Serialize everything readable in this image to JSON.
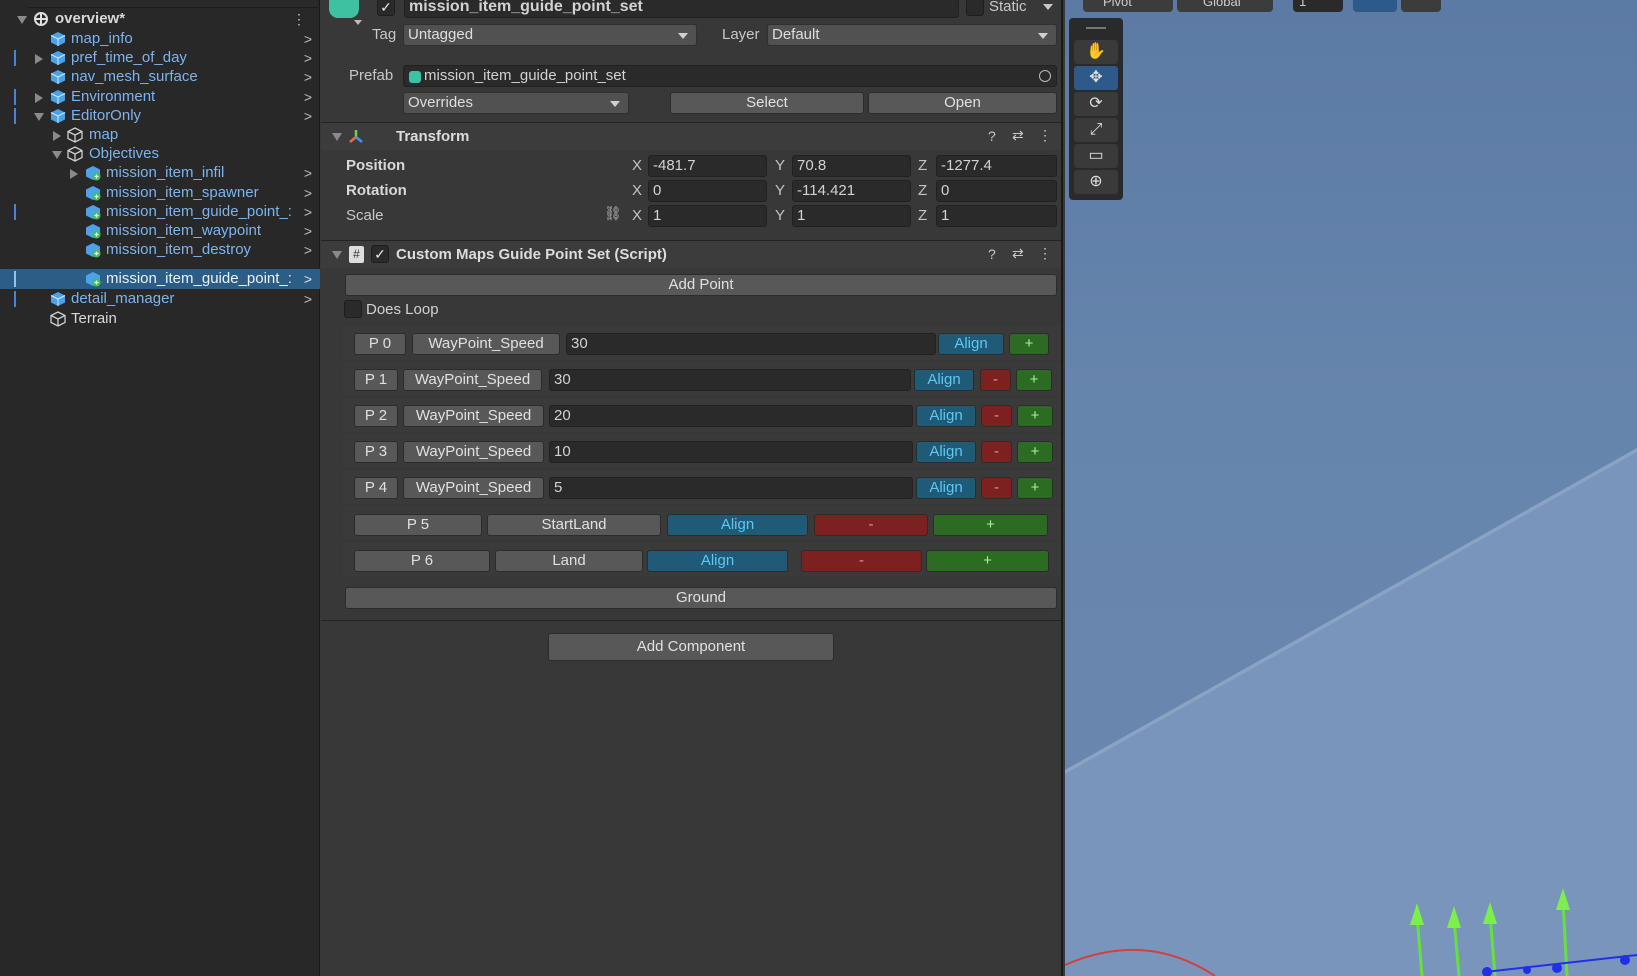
{
  "hierarchy": {
    "items": [
      {
        "label": "overview*",
        "color": "white",
        "bold": true
      },
      {
        "label": "map_info"
      },
      {
        "label": "pref_time_of_day"
      },
      {
        "label": "nav_mesh_surface"
      },
      {
        "label": "Environment"
      },
      {
        "label": "EditorOnly"
      },
      {
        "label": "map"
      },
      {
        "label": "Objectives"
      },
      {
        "label": "mission_item_infil"
      },
      {
        "label": "mission_item_spawner"
      },
      {
        "label": "mission_item_guide_point_:"
      },
      {
        "label": "mission_item_waypoint"
      },
      {
        "label": "mission_item_destroy"
      },
      {
        "label": "mission_item_guide_point_:"
      },
      {
        "label": "detail_manager"
      },
      {
        "label": "Terrain"
      }
    ]
  },
  "inspector": {
    "object_name": "mission_item_guide_point_set",
    "static_label": "Static",
    "tag_label": "Tag",
    "tag_value": "Untagged",
    "layer_label": "Layer",
    "layer_value": "Default",
    "prefab_label": "Prefab",
    "prefab_value": "mission_item_guide_point_set",
    "overrides_label": "Overrides",
    "select_label": "Select",
    "open_label": "Open",
    "transform": {
      "title": "Transform",
      "position_label": "Position",
      "rotation_label": "Rotation",
      "scale_label": "Scale",
      "position": {
        "x": "-481.7",
        "y": "70.8",
        "z": "-1277.4"
      },
      "rotation": {
        "x": "0",
        "y": "-114.421",
        "z": "0"
      },
      "scale": {
        "x": "1",
        "y": "1",
        "z": "1"
      },
      "axis_x": "X",
      "axis_y": "Y",
      "axis_z": "Z"
    },
    "script": {
      "title": "Custom Maps Guide Point Set (Script)",
      "add_point_label": "Add Point",
      "does_loop_label": "Does Loop",
      "ground_label": "Ground",
      "align_label": "Align",
      "minus_label": "-",
      "plus_label": "+",
      "points": [
        {
          "name": "P 0",
          "type": "WayPoint_Speed",
          "value": "30"
        },
        {
          "name": "P 1",
          "type": "WayPoint_Speed",
          "value": "30"
        },
        {
          "name": "P 2",
          "type": "WayPoint_Speed",
          "value": "20"
        },
        {
          "name": "P 3",
          "type": "WayPoint_Speed",
          "value": "10"
        },
        {
          "name": "P 4",
          "type": "WayPoint_Speed",
          "value": "5"
        },
        {
          "name": "P 5",
          "type": "StartLand"
        },
        {
          "name": "P 6",
          "type": "Land"
        }
      ]
    },
    "add_component_label": "Add Component"
  },
  "scene": {
    "pivot_label": "Pivot",
    "global_label": "Global",
    "snap_value": "1",
    "tools": [
      "hand-tool",
      "move-tool",
      "rotate-tool",
      "scale-tool",
      "rect-tool",
      "transform-tool"
    ]
  },
  "colors": {
    "selection": "#2c5d87",
    "link_blue": "#7cb4ef",
    "align": "#1f5a76",
    "minus": "#7c2020",
    "plus": "#2c6b22"
  }
}
